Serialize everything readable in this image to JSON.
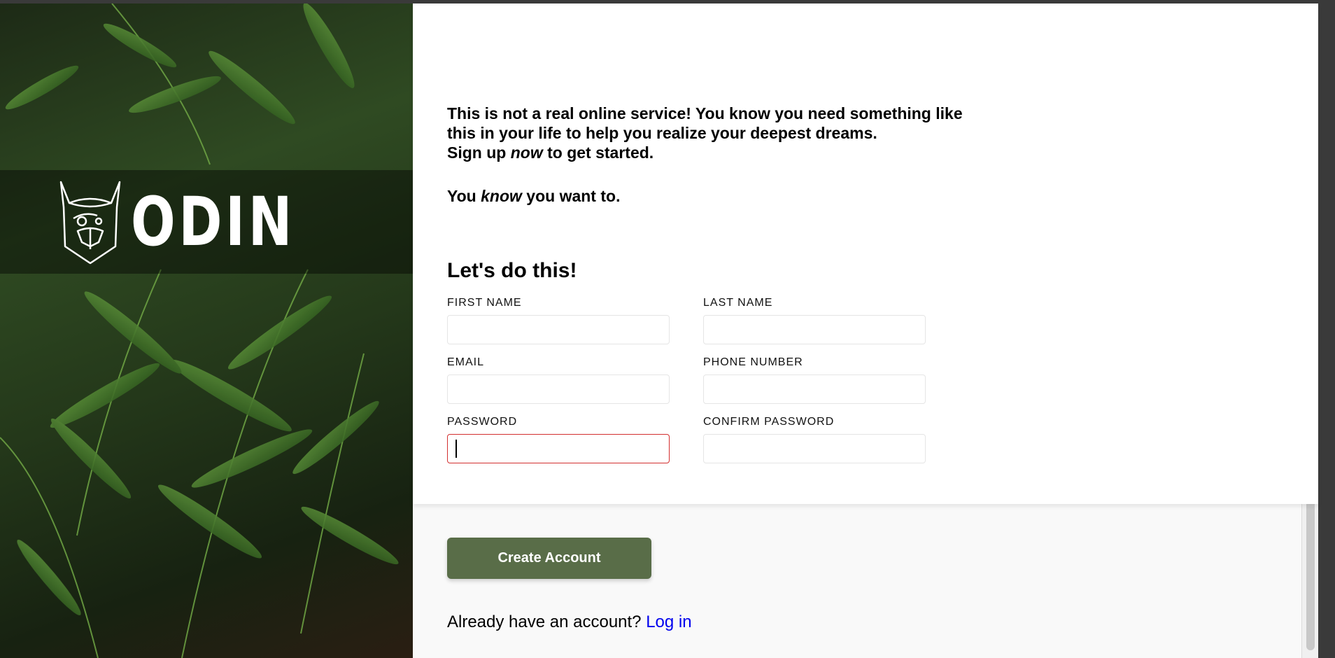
{
  "brand": {
    "logo_text": "ODIN"
  },
  "intro": {
    "line1": "This is not a real online service! You know you need something like",
    "line2": "this in your life to help you realize your deepest dreams.",
    "line3_pre": "Sign up ",
    "line3_em": "now",
    "line3_post": " to get started.",
    "line4_pre": "You ",
    "line4_em": "know",
    "line4_post": " you want to."
  },
  "form": {
    "heading": "Let's do this!",
    "fields": [
      {
        "label": "FIRST NAME",
        "value": ""
      },
      {
        "label": "LAST NAME",
        "value": ""
      },
      {
        "label": "EMAIL",
        "value": ""
      },
      {
        "label": "PHONE NUMBER",
        "value": ""
      },
      {
        "label": "PASSWORD",
        "value": ""
      },
      {
        "label": "CONFIRM PASSWORD",
        "value": ""
      }
    ],
    "submit_label": "Create Account",
    "login_prompt": "Already have an account?",
    "login_link": "Log in"
  },
  "colors": {
    "button": "#596d48",
    "invalid_border": "#d32f2f",
    "link": "#0000ee"
  }
}
